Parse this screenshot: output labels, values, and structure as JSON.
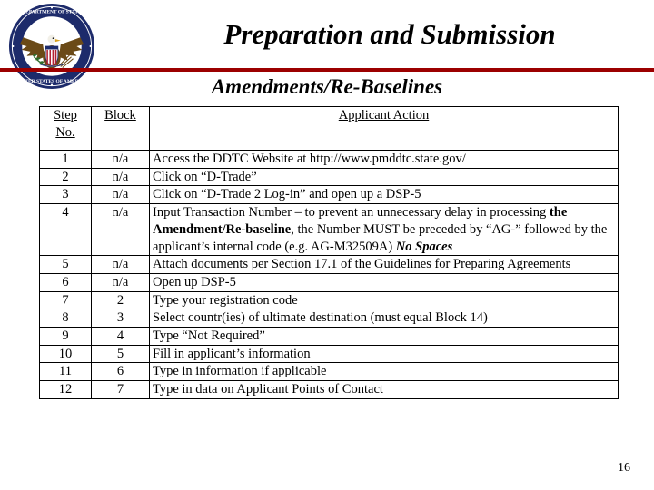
{
  "header": {
    "title": "Preparation and Submission",
    "subtitle": "Amendments/Re-Baselines",
    "seal_alt": "Department of State • United States of America",
    "rule_color": "#9c0000"
  },
  "table": {
    "columns": {
      "step_line1": "Step",
      "step_line2": "No.",
      "block": "Block",
      "action": "Applicant Action"
    },
    "rows": [
      {
        "step": "1",
        "block": "n/a",
        "action": "Access the DDTC Website at http://www.pmddtc.state.gov/"
      },
      {
        "step": "2",
        "block": "n/a",
        "action": "Click on “D-Trade”"
      },
      {
        "step": "3",
        "block": "n/a",
        "action": "Click on “D-Trade 2 Log-in” and open up a DSP-5"
      },
      {
        "step": "4",
        "block": "n/a",
        "action_part1": "Input Transaction Number – to prevent an unnecessary delay in processing ",
        "action_bold": "the Amendment/Re-baseline",
        "action_part2": ", the Number MUST be preceded by “AG-” followed by the applicant’s internal code (e.g. AG-M32509A) ",
        "action_bolditalic": "No Spaces"
      },
      {
        "step": "5",
        "block": "n/a",
        "action": "Attach documents per Section 17.1  of the Guidelines for Preparing Agreements"
      },
      {
        "step": "6",
        "block": "n/a",
        "action": "Open up DSP-5"
      },
      {
        "step": "7",
        "block": "2",
        "action": "Type your registration code"
      },
      {
        "step": "8",
        "block": "3",
        "action": "Select countr(ies) of ultimate destination (must equal Block 14)"
      },
      {
        "step": "9",
        "block": "4",
        "action": "Type “Not Required”"
      },
      {
        "step": "10",
        "block": "5",
        "action": "Fill in applicant’s information"
      },
      {
        "step": "11",
        "block": "6",
        "action": "Type in information if applicable"
      },
      {
        "step": "12",
        "block": "7",
        "action": "Type in data on Applicant Points of Contact"
      }
    ]
  },
  "footer": {
    "page_number": "16"
  }
}
